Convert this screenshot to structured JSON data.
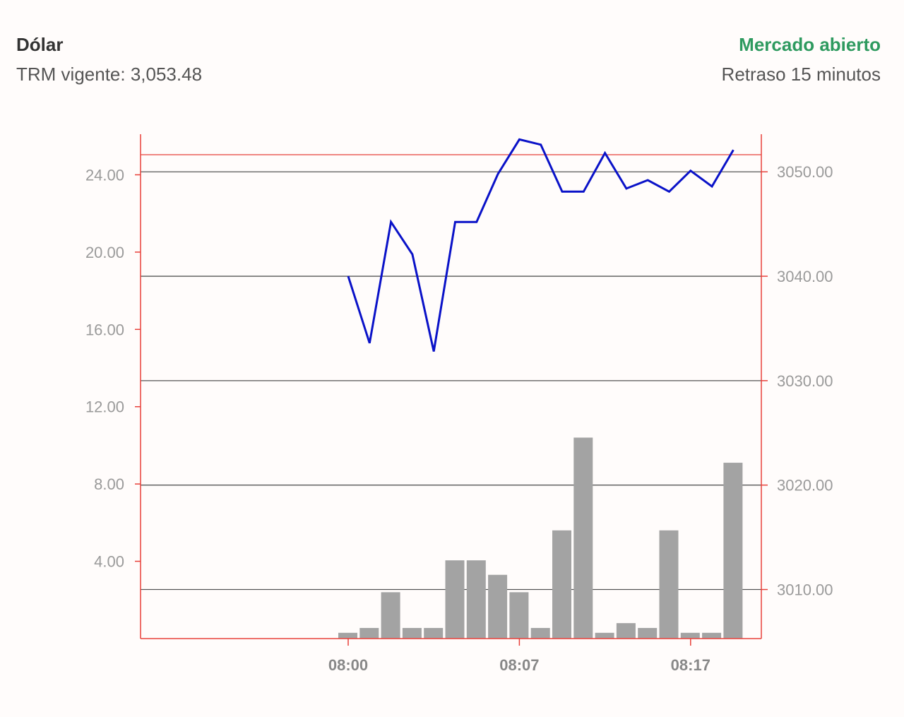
{
  "header": {
    "title": "Dólar",
    "trm_label": "TRM vigente: 3,053.48",
    "market_status": "Mercado abierto",
    "delay_label": "Retraso 15 minutos"
  },
  "colors": {
    "background": "#fffcfb",
    "status_green": "#2e9a5f",
    "axis_red": "#e8403a",
    "line_blue": "#0a12c8",
    "bar_gray": "#a3a3a3",
    "grid_dark": "#555555"
  },
  "chart_data": {
    "type": "line",
    "x_tick_labels": [
      "08:00",
      "08:07",
      "08:17"
    ],
    "y_left": {
      "tick_labels": [
        "24.00",
        "20.00",
        "16.00",
        "12.00",
        "8.00",
        "4.00"
      ],
      "ticks": [
        24,
        20,
        16,
        12,
        8,
        4
      ],
      "range": [
        0,
        26.1
      ]
    },
    "y_right": {
      "tick_labels": [
        "3050.00",
        "3040.00",
        "3030.00",
        "3020.00",
        "3010.00"
      ],
      "ticks": [
        3050,
        3040,
        3030,
        3020,
        3010
      ],
      "range": [
        3005.3,
        3053.6
      ]
    },
    "series": [
      {
        "kind": "line",
        "axis": "right",
        "values": [
          3040.0,
          3033.6,
          3045.2,
          3042.1,
          3032.8,
          3045.2,
          3045.2,
          3049.8,
          3053.1,
          3052.6,
          3048.1,
          3048.1,
          3051.8,
          3048.4,
          3049.2,
          3048.1,
          3050.1,
          3048.6,
          3052.1
        ]
      },
      {
        "kind": "bar",
        "axis": "left",
        "values": [
          0.3,
          0.55,
          2.4,
          0.55,
          0.55,
          4.05,
          4.05,
          3.3,
          2.4,
          0.55,
          5.6,
          10.4,
          0.3,
          0.8,
          0.55,
          5.6,
          0.3,
          0.3,
          9.1
        ]
      }
    ],
    "grid": true
  }
}
